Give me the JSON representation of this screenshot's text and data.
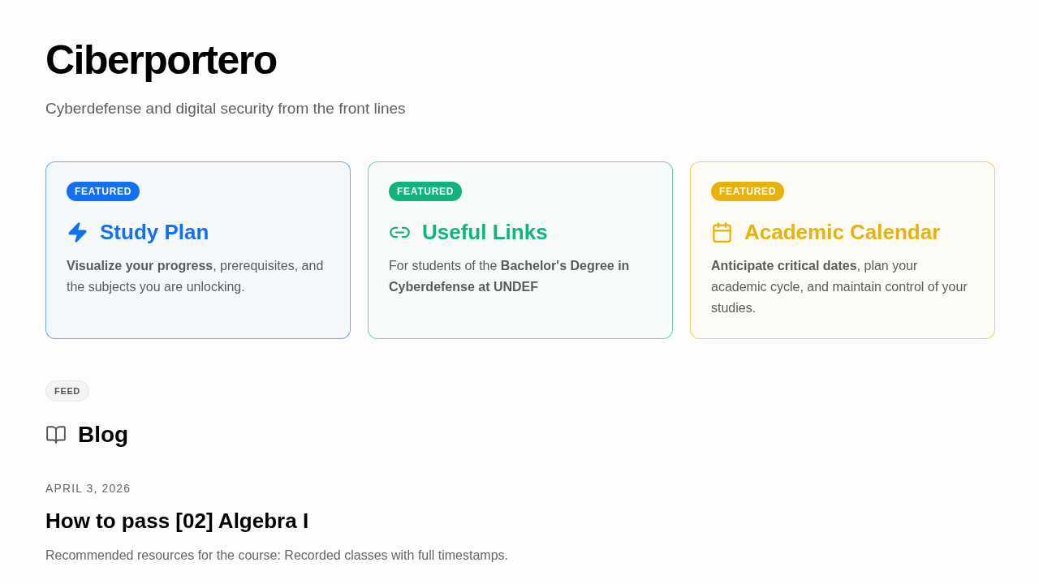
{
  "site": {
    "title": "Ciberportero",
    "tagline": "Cyberdefense and digital security from the front lines"
  },
  "featured_cards": [
    {
      "badge": "FEATURED",
      "title": "Study Plan",
      "description": "**Visualize your progress**, prerequisites, and the subjects you are unlocking.",
      "color": "#1570ef"
    },
    {
      "badge": "FEATURED",
      "title": "Useful Links",
      "description": "For students of the **Bachelor's Degree in Cyberdefense at UNDEF**",
      "color": "#13b47b"
    },
    {
      "badge": "FEATURED",
      "title": "Academic Calendar",
      "description": "**Anticipate critical dates**, plan your academic cycle, and maintain control of your studies.",
      "color": "#e8b20c"
    }
  ],
  "feed": {
    "badge": "FEED",
    "heading": "Blog",
    "posts": [
      {
        "date": "APRIL 3, 2026",
        "title": "How to pass [02] Algebra I",
        "summary": "Recommended resources for the course: Recorded classes with full timestamps."
      }
    ]
  }
}
